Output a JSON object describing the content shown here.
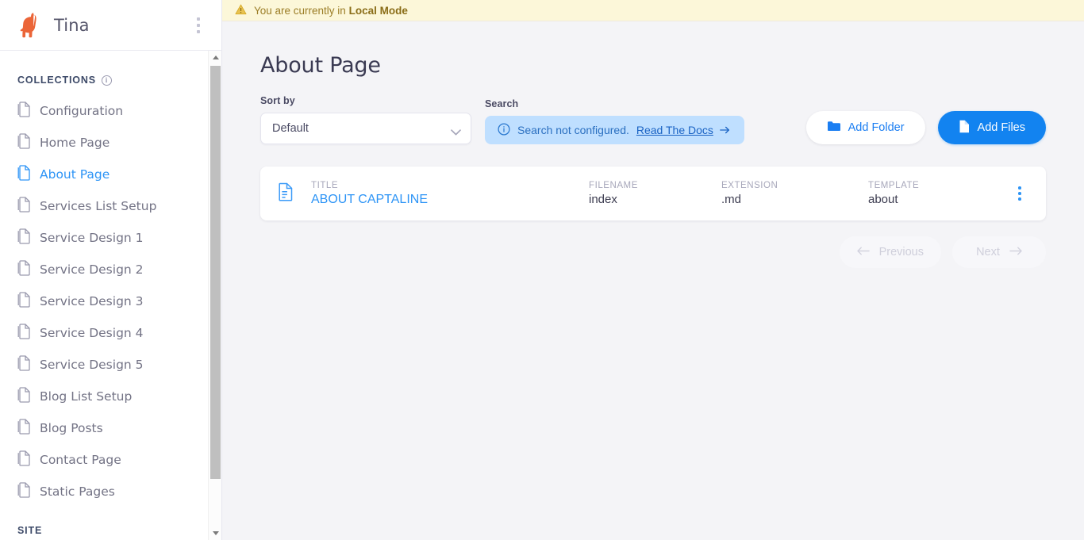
{
  "sidebar": {
    "app_title": "Tina",
    "logo_icon": "llama-logo",
    "header_menu_icon": "kebab-menu-icon",
    "collections_label": "COLLECTIONS",
    "collections_info_icon": "info-icon",
    "site_label": "SITE",
    "items": [
      {
        "label": "Configuration",
        "icon": "document-icon",
        "active": false
      },
      {
        "label": "Home Page",
        "icon": "document-icon",
        "active": false
      },
      {
        "label": "About Page",
        "icon": "document-icon",
        "active": true
      },
      {
        "label": "Services List Setup",
        "icon": "document-icon",
        "active": false
      },
      {
        "label": "Service Design 1",
        "icon": "document-icon",
        "active": false
      },
      {
        "label": "Service Design 2",
        "icon": "document-icon",
        "active": false
      },
      {
        "label": "Service Design 3",
        "icon": "document-icon",
        "active": false
      },
      {
        "label": "Service Design 4",
        "icon": "document-icon",
        "active": false
      },
      {
        "label": "Service Design 5",
        "icon": "document-icon",
        "active": false
      },
      {
        "label": "Blog List Setup",
        "icon": "document-icon",
        "active": false
      },
      {
        "label": "Blog Posts",
        "icon": "document-icon",
        "active": false
      },
      {
        "label": "Contact Page",
        "icon": "document-icon",
        "active": false
      },
      {
        "label": "Static Pages",
        "icon": "document-icon",
        "active": false
      }
    ]
  },
  "banner": {
    "icon": "warning-triangle-icon",
    "text_prefix": "You are currently in ",
    "text_strong": "Local Mode"
  },
  "main": {
    "page_title": "About Page",
    "sort": {
      "label": "Sort by",
      "value": "Default",
      "chevron_icon": "chevron-down-icon"
    },
    "search": {
      "label": "Search",
      "info_icon": "info-circle-icon",
      "message": "Search not configured.",
      "link_label": "Read The Docs",
      "link_arrow_icon": "arrow-right-icon"
    },
    "actions": {
      "add_folder_label": "Add Folder",
      "add_folder_icon": "folder-icon",
      "add_files_label": "Add Files",
      "add_files_icon": "file-icon"
    },
    "table": {
      "row_icon": "document-lines-icon",
      "row_menu_icon": "kebab-menu-icon",
      "columns": [
        "TITLE",
        "FILENAME",
        "EXTENSION",
        "TEMPLATE"
      ],
      "rows": [
        {
          "title": "ABOUT CAPTALINE",
          "filename": "index",
          "extension": ".md",
          "template": "about"
        }
      ]
    },
    "pagination": {
      "previous_label": "Previous",
      "previous_icon": "arrow-left-icon",
      "next_label": "Next",
      "next_icon": "arrow-right-icon"
    }
  },
  "colors": {
    "accent_blue": "#1283f0",
    "link_blue": "#2d94f6",
    "brand_orange": "#eb6538",
    "banner_yellow": "#fcf7d9",
    "banner_text": "#9b7d26",
    "page_bg": "#f4f4f7"
  }
}
